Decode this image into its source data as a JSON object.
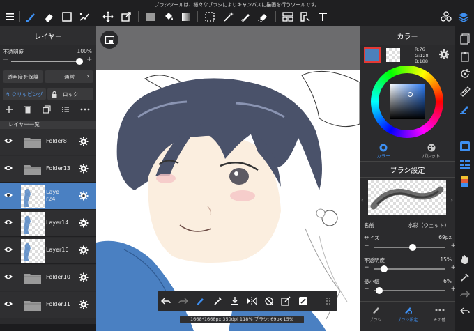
{
  "top": {
    "tip": "ブラシツールは、様々なブラシによりキャンバスに描画を行うツールです。"
  },
  "layer_panel": {
    "title": "レイヤー",
    "opacity_label": "不透明度",
    "opacity_value": "100%",
    "opacity_fraction": 1.0,
    "protect_label": "透明度を保護",
    "blend_label": "通常",
    "clipping_label": "クリッピング",
    "lock_label": "ロック",
    "list_header": "レイヤー一覧",
    "layers": [
      {
        "name": "Folder8",
        "kind": "folder"
      },
      {
        "name": "Folder13",
        "kind": "folder"
      },
      {
        "name": "Laye r24",
        "kind": "layer",
        "selected": true
      },
      {
        "name": "Layer14",
        "kind": "layer"
      },
      {
        "name": "Layer16",
        "kind": "layer"
      },
      {
        "name": "Folder10",
        "kind": "folder"
      },
      {
        "name": "Folder11",
        "kind": "folder"
      }
    ]
  },
  "canvas": {
    "status": "1668*1668px 350dpi 118% ブラシ: 69px 15%"
  },
  "color_panel": {
    "title": "カラー",
    "rgb": {
      "r": "R:76",
      "g": "G:128",
      "b": "B:188"
    },
    "main_color": "#4c80bc",
    "tab_color": "カラー",
    "tab_palette": "パレット"
  },
  "brush_panel": {
    "title": "ブラシ設定",
    "name_label": "名前",
    "name_value": "水彩（ウェット）",
    "size_label": "サイズ",
    "size_value": "69px",
    "size_fraction": 0.55,
    "opacity_label": "不透明度",
    "opacity_value": "15%",
    "opacity_fraction": 0.15,
    "min_label": "最小幅",
    "min_value": "6%",
    "min_fraction": 0.08,
    "tab_brush": "ブラシ",
    "tab_settings": "ブラシ設定",
    "tab_other": "その他"
  }
}
